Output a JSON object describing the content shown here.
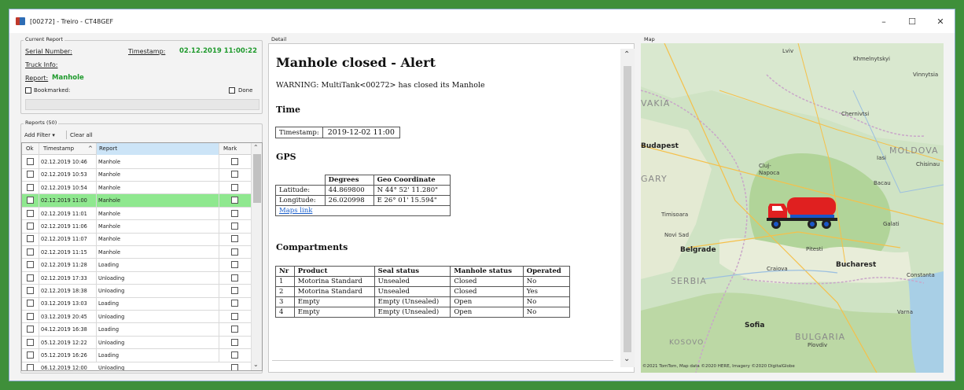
{
  "window": {
    "title": "[00272] - Treiro - CT48GEF",
    "controls": [
      "–",
      "☐",
      "✕"
    ]
  },
  "current_report": {
    "group_title": "Current Report",
    "serial_number_label": "Serial Number:",
    "serial_number_value": "",
    "timestamp_label": "Timestamp:",
    "timestamp_value": "02.12.2019 11:00:22",
    "truck_info_label": "Truck Info:",
    "truck_info_value": "",
    "report_label": "Report:",
    "report_value": "Manhole",
    "bookmarked_label": "Bookmarked:",
    "done_label": "Done"
  },
  "reports": {
    "group_title": "Reports (50)",
    "add_filter_label": "Add Filter ▾",
    "clear_all_label": "Clear all",
    "columns": [
      "Ok",
      "Timestamp",
      "Report",
      "Mark"
    ],
    "sort_indicator": "^",
    "rows": [
      {
        "timestamp": "02.12.2019 10:46",
        "report": "Manhole",
        "selected": false
      },
      {
        "timestamp": "02.12.2019 10:53",
        "report": "Manhole",
        "selected": false
      },
      {
        "timestamp": "02.12.2019 10:54",
        "report": "Manhole",
        "selected": false
      },
      {
        "timestamp": "02.12.2019 11:00",
        "report": "Manhole",
        "selected": true
      },
      {
        "timestamp": "02.12.2019 11:01",
        "report": "Manhole",
        "selected": false
      },
      {
        "timestamp": "02.12.2019 11:06",
        "report": "Manhole",
        "selected": false
      },
      {
        "timestamp": "02.12.2019 11:07",
        "report": "Manhole",
        "selected": false
      },
      {
        "timestamp": "02.12.2019 11:15",
        "report": "Manhole",
        "selected": false
      },
      {
        "timestamp": "02.12.2019 11:28",
        "report": "Loading",
        "selected": false
      },
      {
        "timestamp": "02.12.2019 17:33",
        "report": "Unloading",
        "selected": false
      },
      {
        "timestamp": "02.12.2019 18:38",
        "report": "Unloading",
        "selected": false
      },
      {
        "timestamp": "03.12.2019 13:03",
        "report": "Loading",
        "selected": false
      },
      {
        "timestamp": "03.12.2019 20:45",
        "report": "Unloading",
        "selected": false
      },
      {
        "timestamp": "04.12.2019 16:38",
        "report": "Loading",
        "selected": false
      },
      {
        "timestamp": "05.12.2019 12:22",
        "report": "Unloading",
        "selected": false
      },
      {
        "timestamp": "05.12.2019 16:26",
        "report": "Loading",
        "selected": false
      },
      {
        "timestamp": "06.12.2019 12:00",
        "report": "Unloading",
        "selected": false
      }
    ]
  },
  "detail": {
    "group_title": "Detail",
    "heading": "Manhole closed - Alert",
    "warning": "WARNING: MultiTank<00272> has closed its Manhole",
    "time_heading": "Time",
    "timestamp_label": "Timestamp:",
    "timestamp_value": "2019-12-02 11:00",
    "gps_heading": "GPS",
    "gps_headers": [
      "",
      "Degrees",
      "Geo Coordinate"
    ],
    "gps_rows": [
      {
        "label": "Latitude:",
        "degrees": "44.869800",
        "geo": "N 44° 52' 11.280\""
      },
      {
        "label": "Longitude:",
        "degrees": "26.020998",
        "geo": "E 26° 01' 15.594\""
      }
    ],
    "maps_link": "Maps link",
    "compartments_heading": "Compartments",
    "compartment_headers": [
      "Nr",
      "Product",
      "Seal status",
      "Manhole status",
      "Operated"
    ],
    "compartments": [
      {
        "nr": "1",
        "product": "Motorina Standard",
        "seal": "Unsealed",
        "manhole": "Closed",
        "operated": "No"
      },
      {
        "nr": "2",
        "product": "Motorina Standard",
        "seal": "Unsealed",
        "manhole": "Closed",
        "operated": "Yes"
      },
      {
        "nr": "3",
        "product": "Empty",
        "seal": "Empty (Unsealed)",
        "manhole": "Open",
        "operated": "No"
      },
      {
        "nr": "4",
        "product": "Empty",
        "seal": "Empty (Unsealed)",
        "manhole": "Open",
        "operated": "No"
      }
    ]
  },
  "map": {
    "group_title": "Map",
    "labels": {
      "lviv": "Lviv",
      "khmelnytskyi": "Khmelnytskyi",
      "vinnytsia": "Vinnytsia",
      "chernivtsi": "Chernivtsi",
      "vakia": "VAKIA",
      "moldova": "MOLDOVA",
      "budapest": "Budapest",
      "chisinau": "Chisinau",
      "gary": "GARY",
      "cluj": "Cluj-Napoca",
      "iasi": "Iasi",
      "bacau": "Bacau",
      "timisoara": "Timisoara",
      "galati": "Galati",
      "novi_sad": "Novi Sad",
      "pitesti": "Pitesti",
      "belgrade": "Belgrade",
      "bucharest": "Bucharest",
      "constanta": "Constanta",
      "craiova": "Craiova",
      "serbia": "SERBIA",
      "varna": "Varna",
      "sofia": "Sofia",
      "bulgaria": "BULGARIA",
      "plovdiv": "Plovdiv",
      "kosovo": "KOSOVO",
      "credits": "©2021 TomTom, Map data ©2020 HERE, Imagery ©2020 DigitalGlobe"
    }
  }
}
